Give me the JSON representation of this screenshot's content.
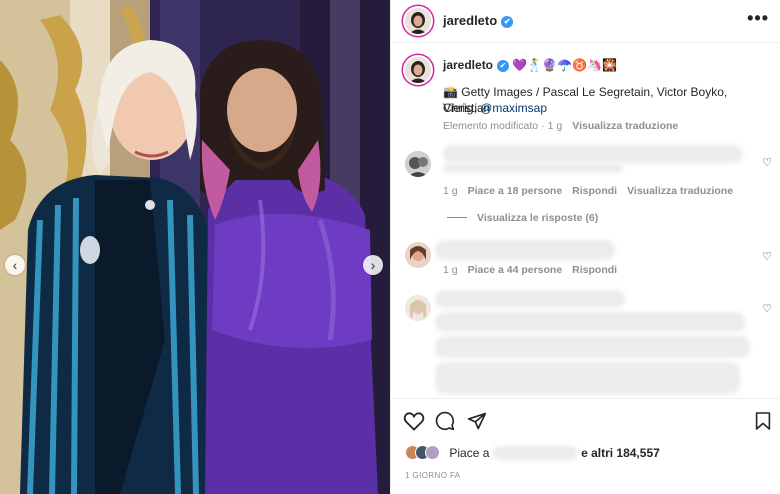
{
  "post": {
    "username": "jaredleto",
    "verified_badge": "✔",
    "more_glyph": "•••",
    "carousel": {
      "prev_glyph": "‹",
      "next_glyph": "›"
    }
  },
  "caption": {
    "username": "jaredleto",
    "emojis": "💜🕺🔮☂️♉🦄🎇",
    "camera_emoji": "📸",
    "credit_text": "Getty Images / Pascal Le Segretain, Victor Boyko, Christian",
    "credit_text_2": "Vierig,",
    "mention": "@maximsap",
    "meta": {
      "edited": "Elemento modificato",
      "sep": "·",
      "age": "1 g",
      "translate": "Visualizza traduzione"
    }
  },
  "comments": [
    {
      "age": "1 g",
      "likes": "Piace a 18 persone",
      "reply": "Rispondi",
      "translate": "Visualizza traduzione",
      "view_replies": "Visualizza le risposte (6)"
    },
    {
      "age": "1 g",
      "likes": "Piace a 44 persone",
      "reply": "Rispondi"
    },
    {}
  ],
  "actions": {
    "like_prefix": "Piace a",
    "like_suffix": "e altri 184,557",
    "timestamp": "1 GIORNO FA"
  },
  "colors": {
    "accent": "#3897f0",
    "link": "#00376b",
    "muted": "#8e8e8e",
    "story_ring": "#d6249f"
  }
}
